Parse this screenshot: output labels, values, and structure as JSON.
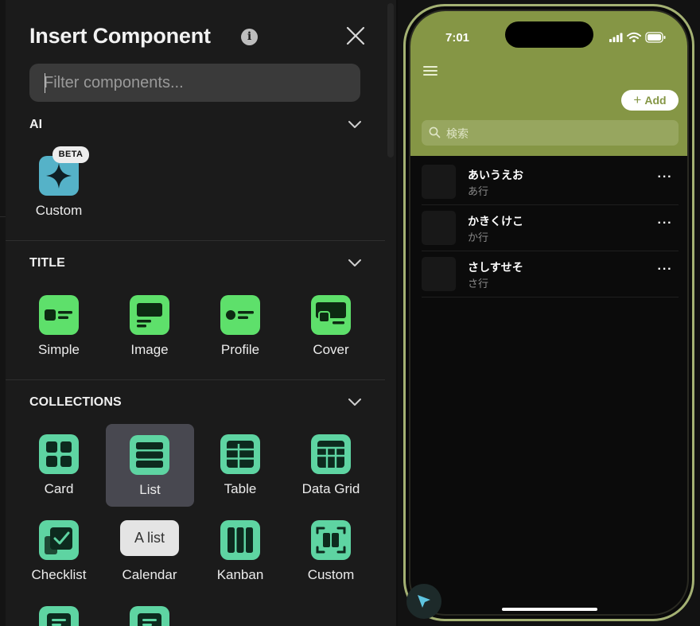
{
  "panel": {
    "title": "Insert Component",
    "filter": {
      "value": "",
      "placeholder": "Filter components..."
    },
    "sections": [
      {
        "heading": "AI",
        "items": [
          {
            "label": "Custom",
            "badge": "BETA",
            "icon": "sparkle-icon"
          }
        ]
      },
      {
        "heading": "TITLE",
        "items": [
          {
            "label": "Simple",
            "icon": "title-simple-icon"
          },
          {
            "label": "Image",
            "icon": "title-image-icon"
          },
          {
            "label": "Profile",
            "icon": "title-profile-icon"
          },
          {
            "label": "Cover",
            "icon": "title-cover-icon"
          }
        ]
      },
      {
        "heading": "COLLECTIONS",
        "items": [
          {
            "label": "Card",
            "icon": "card-grid-icon"
          },
          {
            "label": "List",
            "icon": "list-icon",
            "selected": true
          },
          {
            "label": "Table",
            "icon": "table-icon"
          },
          {
            "label": "Data Grid",
            "icon": "data-grid-icon"
          },
          {
            "label": "Checklist",
            "icon": "checklist-icon"
          },
          {
            "label": "Calendar",
            "icon": "calendar-icon"
          },
          {
            "label": "Kanban",
            "icon": "kanban-icon"
          },
          {
            "label": "Custom",
            "icon": "custom-collection-icon"
          }
        ]
      }
    ],
    "tooltip": "A list"
  },
  "phone": {
    "status_time": "7:01",
    "add_button": {
      "plus": "+",
      "label": "Add"
    },
    "search_placeholder": "検索",
    "rows": [
      {
        "title": "あいうえお",
        "subtitle": "あ行"
      },
      {
        "title": "かきくけこ",
        "subtitle": "か行"
      },
      {
        "title": "さしすせそ",
        "subtitle": "さ行"
      }
    ],
    "more_glyph": "···"
  },
  "colors": {
    "tile_green": "#5ee06b",
    "tile_teal": "#5ed4a2",
    "tile_ai": "#55b2c8",
    "app_header": "#859645",
    "phone_frame": "#a4b173",
    "selected_item": "#484850"
  }
}
